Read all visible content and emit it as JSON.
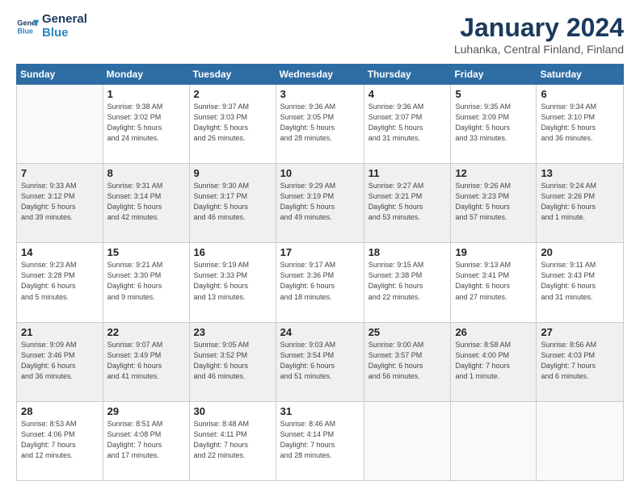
{
  "logo": {
    "line1": "General",
    "line2": "Blue"
  },
  "title": "January 2024",
  "subtitle": "Luhanka, Central Finland, Finland",
  "days_header": [
    "Sunday",
    "Monday",
    "Tuesday",
    "Wednesday",
    "Thursday",
    "Friday",
    "Saturday"
  ],
  "weeks": [
    [
      {
        "day": "",
        "info": ""
      },
      {
        "day": "1",
        "info": "Sunrise: 9:38 AM\nSunset: 3:02 PM\nDaylight: 5 hours\nand 24 minutes."
      },
      {
        "day": "2",
        "info": "Sunrise: 9:37 AM\nSunset: 3:03 PM\nDaylight: 5 hours\nand 26 minutes."
      },
      {
        "day": "3",
        "info": "Sunrise: 9:36 AM\nSunset: 3:05 PM\nDaylight: 5 hours\nand 28 minutes."
      },
      {
        "day": "4",
        "info": "Sunrise: 9:36 AM\nSunset: 3:07 PM\nDaylight: 5 hours\nand 31 minutes."
      },
      {
        "day": "5",
        "info": "Sunrise: 9:35 AM\nSunset: 3:09 PM\nDaylight: 5 hours\nand 33 minutes."
      },
      {
        "day": "6",
        "info": "Sunrise: 9:34 AM\nSunset: 3:10 PM\nDaylight: 5 hours\nand 36 minutes."
      }
    ],
    [
      {
        "day": "7",
        "info": "Sunrise: 9:33 AM\nSunset: 3:12 PM\nDaylight: 5 hours\nand 39 minutes."
      },
      {
        "day": "8",
        "info": "Sunrise: 9:31 AM\nSunset: 3:14 PM\nDaylight: 5 hours\nand 42 minutes."
      },
      {
        "day": "9",
        "info": "Sunrise: 9:30 AM\nSunset: 3:17 PM\nDaylight: 5 hours\nand 46 minutes."
      },
      {
        "day": "10",
        "info": "Sunrise: 9:29 AM\nSunset: 3:19 PM\nDaylight: 5 hours\nand 49 minutes."
      },
      {
        "day": "11",
        "info": "Sunrise: 9:27 AM\nSunset: 3:21 PM\nDaylight: 5 hours\nand 53 minutes."
      },
      {
        "day": "12",
        "info": "Sunrise: 9:26 AM\nSunset: 3:23 PM\nDaylight: 5 hours\nand 57 minutes."
      },
      {
        "day": "13",
        "info": "Sunrise: 9:24 AM\nSunset: 3:26 PM\nDaylight: 6 hours\nand 1 minute."
      }
    ],
    [
      {
        "day": "14",
        "info": "Sunrise: 9:23 AM\nSunset: 3:28 PM\nDaylight: 6 hours\nand 5 minutes."
      },
      {
        "day": "15",
        "info": "Sunrise: 9:21 AM\nSunset: 3:30 PM\nDaylight: 6 hours\nand 9 minutes."
      },
      {
        "day": "16",
        "info": "Sunrise: 9:19 AM\nSunset: 3:33 PM\nDaylight: 6 hours\nand 13 minutes."
      },
      {
        "day": "17",
        "info": "Sunrise: 9:17 AM\nSunset: 3:36 PM\nDaylight: 6 hours\nand 18 minutes."
      },
      {
        "day": "18",
        "info": "Sunrise: 9:15 AM\nSunset: 3:38 PM\nDaylight: 6 hours\nand 22 minutes."
      },
      {
        "day": "19",
        "info": "Sunrise: 9:13 AM\nSunset: 3:41 PM\nDaylight: 6 hours\nand 27 minutes."
      },
      {
        "day": "20",
        "info": "Sunrise: 9:11 AM\nSunset: 3:43 PM\nDaylight: 6 hours\nand 31 minutes."
      }
    ],
    [
      {
        "day": "21",
        "info": "Sunrise: 9:09 AM\nSunset: 3:46 PM\nDaylight: 6 hours\nand 36 minutes."
      },
      {
        "day": "22",
        "info": "Sunrise: 9:07 AM\nSunset: 3:49 PM\nDaylight: 6 hours\nand 41 minutes."
      },
      {
        "day": "23",
        "info": "Sunrise: 9:05 AM\nSunset: 3:52 PM\nDaylight: 6 hours\nand 46 minutes."
      },
      {
        "day": "24",
        "info": "Sunrise: 9:03 AM\nSunset: 3:54 PM\nDaylight: 6 hours\nand 51 minutes."
      },
      {
        "day": "25",
        "info": "Sunrise: 9:00 AM\nSunset: 3:57 PM\nDaylight: 6 hours\nand 56 minutes."
      },
      {
        "day": "26",
        "info": "Sunrise: 8:58 AM\nSunset: 4:00 PM\nDaylight: 7 hours\nand 1 minute."
      },
      {
        "day": "27",
        "info": "Sunrise: 8:56 AM\nSunset: 4:03 PM\nDaylight: 7 hours\nand 6 minutes."
      }
    ],
    [
      {
        "day": "28",
        "info": "Sunrise: 8:53 AM\nSunset: 4:06 PM\nDaylight: 7 hours\nand 12 minutes."
      },
      {
        "day": "29",
        "info": "Sunrise: 8:51 AM\nSunset: 4:08 PM\nDaylight: 7 hours\nand 17 minutes."
      },
      {
        "day": "30",
        "info": "Sunrise: 8:48 AM\nSunset: 4:11 PM\nDaylight: 7 hours\nand 22 minutes."
      },
      {
        "day": "31",
        "info": "Sunrise: 8:46 AM\nSunset: 4:14 PM\nDaylight: 7 hours\nand 28 minutes."
      },
      {
        "day": "",
        "info": ""
      },
      {
        "day": "",
        "info": ""
      },
      {
        "day": "",
        "info": ""
      }
    ]
  ]
}
